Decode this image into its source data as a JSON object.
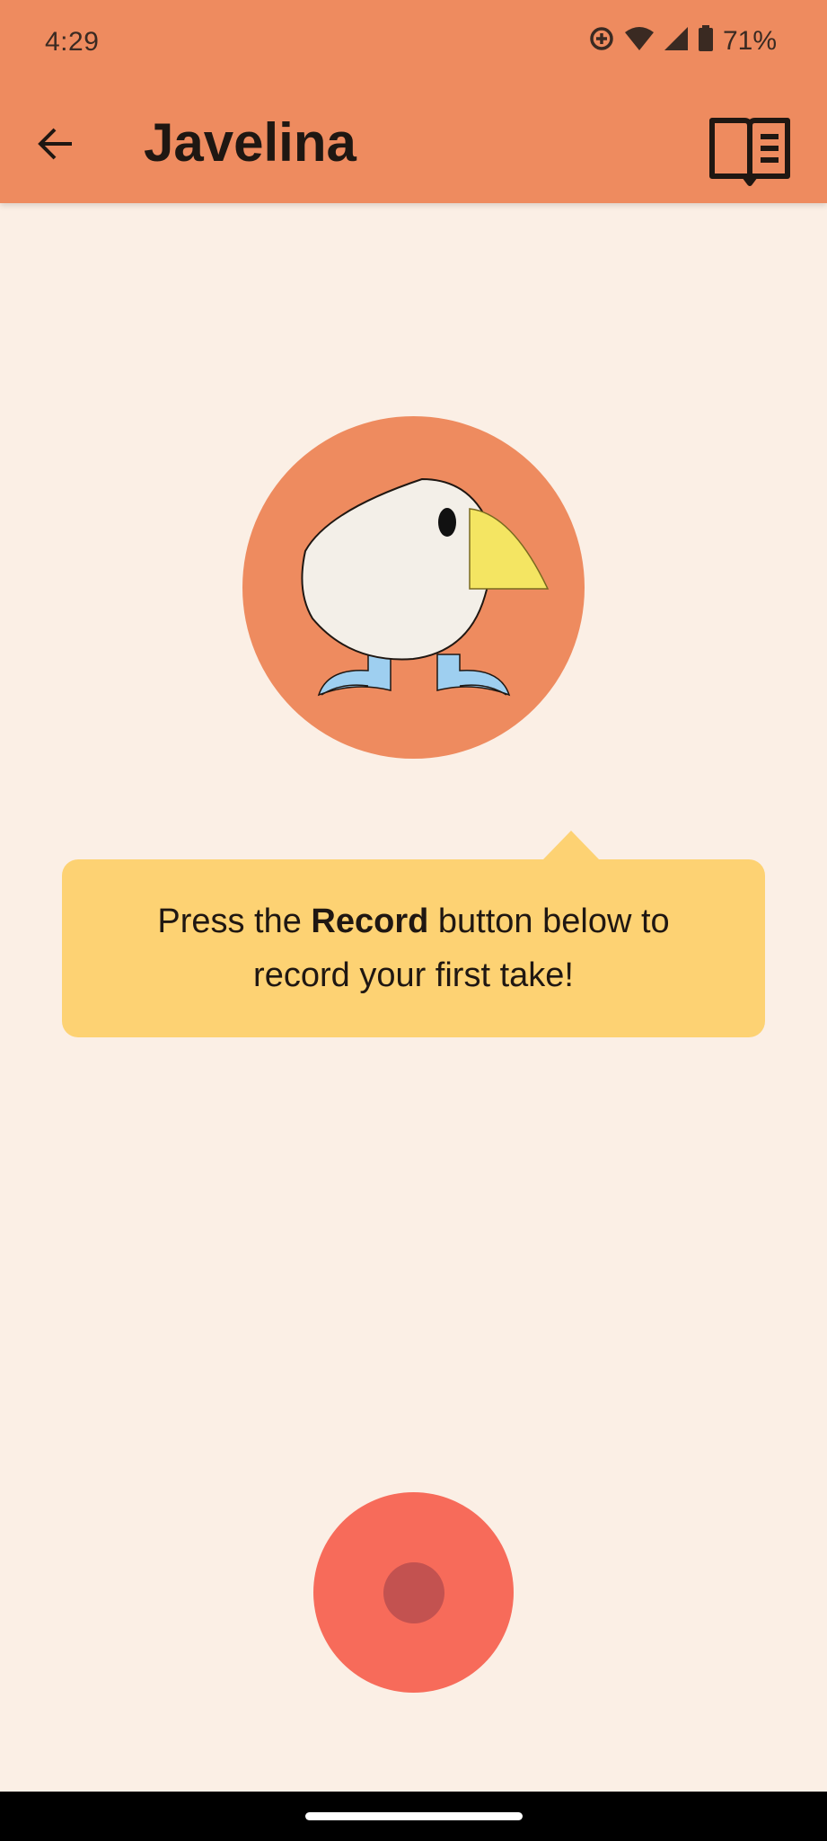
{
  "status_bar": {
    "time": "4:29",
    "battery_percent": "71%",
    "icons": [
      "data-saver-icon",
      "wifi-icon",
      "cell-signal-icon",
      "battery-icon"
    ]
  },
  "app_bar": {
    "title": "Javelina",
    "back_icon": "arrow-back-icon",
    "action_icon": "book-icon",
    "color": "#ee8b5f"
  },
  "avatar": {
    "icon": "bird-avatar",
    "background": "#ee8b5f"
  },
  "tooltip": {
    "text_before": "Press the ",
    "text_bold": "Record",
    "text_after": " button below to record your first take!",
    "background": "#fdd273"
  },
  "record_button": {
    "icon": "record-dot-icon",
    "color": "#f76b5a",
    "inner_color": "#c35250"
  },
  "colors": {
    "page_background": "#fbefe5"
  }
}
